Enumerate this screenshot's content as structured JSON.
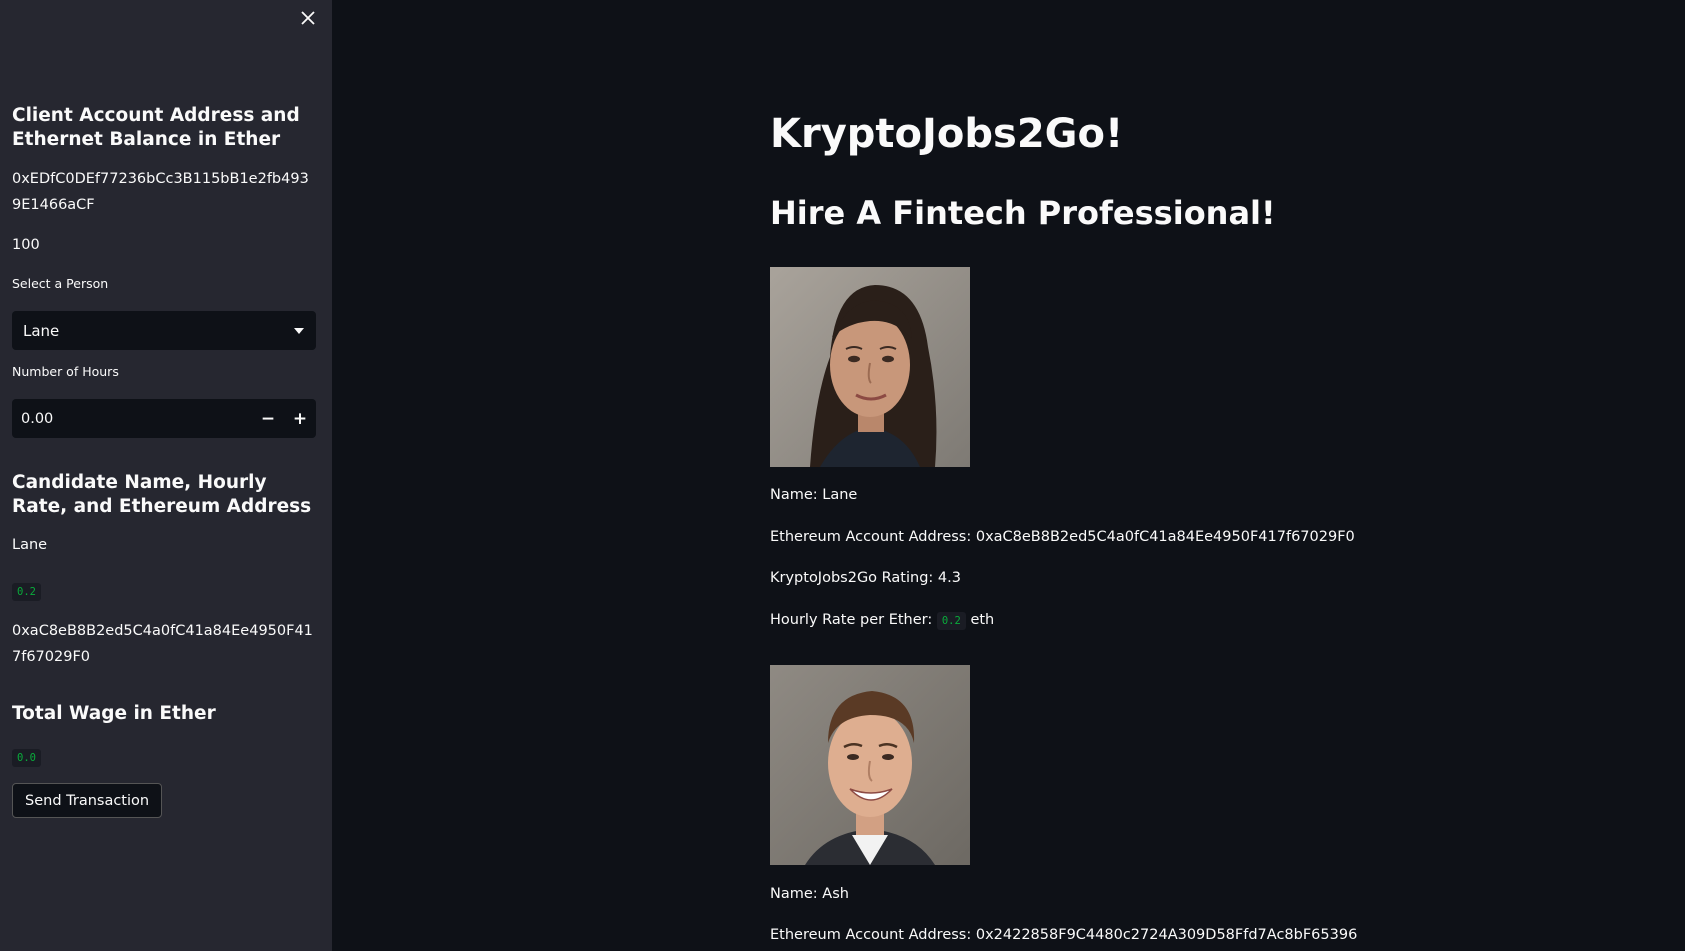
{
  "sidebar": {
    "account_heading": "Client Account Address and Ethernet Balance in Ether",
    "client_address": "0xEDfC0DEf77236bCc3B115bB1e2fb4939E1466aCF",
    "balance": "100",
    "select_label": "Select a Person",
    "selected_person": "Lane",
    "hours_label": "Number of Hours",
    "hours_value": "0.00",
    "decrement_label": "−",
    "increment_label": "+",
    "candidate_heading": "Candidate Name, Hourly Rate, and Ethereum Address",
    "candidate_name": "Lane",
    "candidate_rate": "0.2",
    "candidate_address": "0xaC8eB8B2ed5C4a0fC41a84Ee4950F417f67029F0",
    "wage_heading": "Total Wage in Ether",
    "wage_value": "0.0",
    "send_button": "Send Transaction"
  },
  "main": {
    "title": "KryptoJobs2Go!",
    "subtitle": "Hire A Fintech Professional!",
    "candidates": [
      {
        "name_line": "Name: Lane",
        "address_line": "Ethereum Account Address: 0xaC8eB8B2ed5C4a0fC41a84Ee4950F417f67029F0",
        "rating_line": "KryptoJobs2Go Rating: 4.3",
        "rate_prefix": "Hourly Rate per Ether:",
        "rate_value": "0.2",
        "rate_suffix": "eth"
      },
      {
        "name_line": "Name: Ash",
        "address_line": "Ethereum Account Address: 0x2422858F9C4480c2724A309D58Ffd7Ac8bF65396"
      }
    ]
  },
  "colors": {
    "main_bg": "#0e1117",
    "sidebar_bg": "#262730",
    "code_text": "#09ab3b"
  },
  "icons": [
    "close-icon",
    "chevron-down-icon",
    "minus-icon",
    "plus-icon"
  ]
}
